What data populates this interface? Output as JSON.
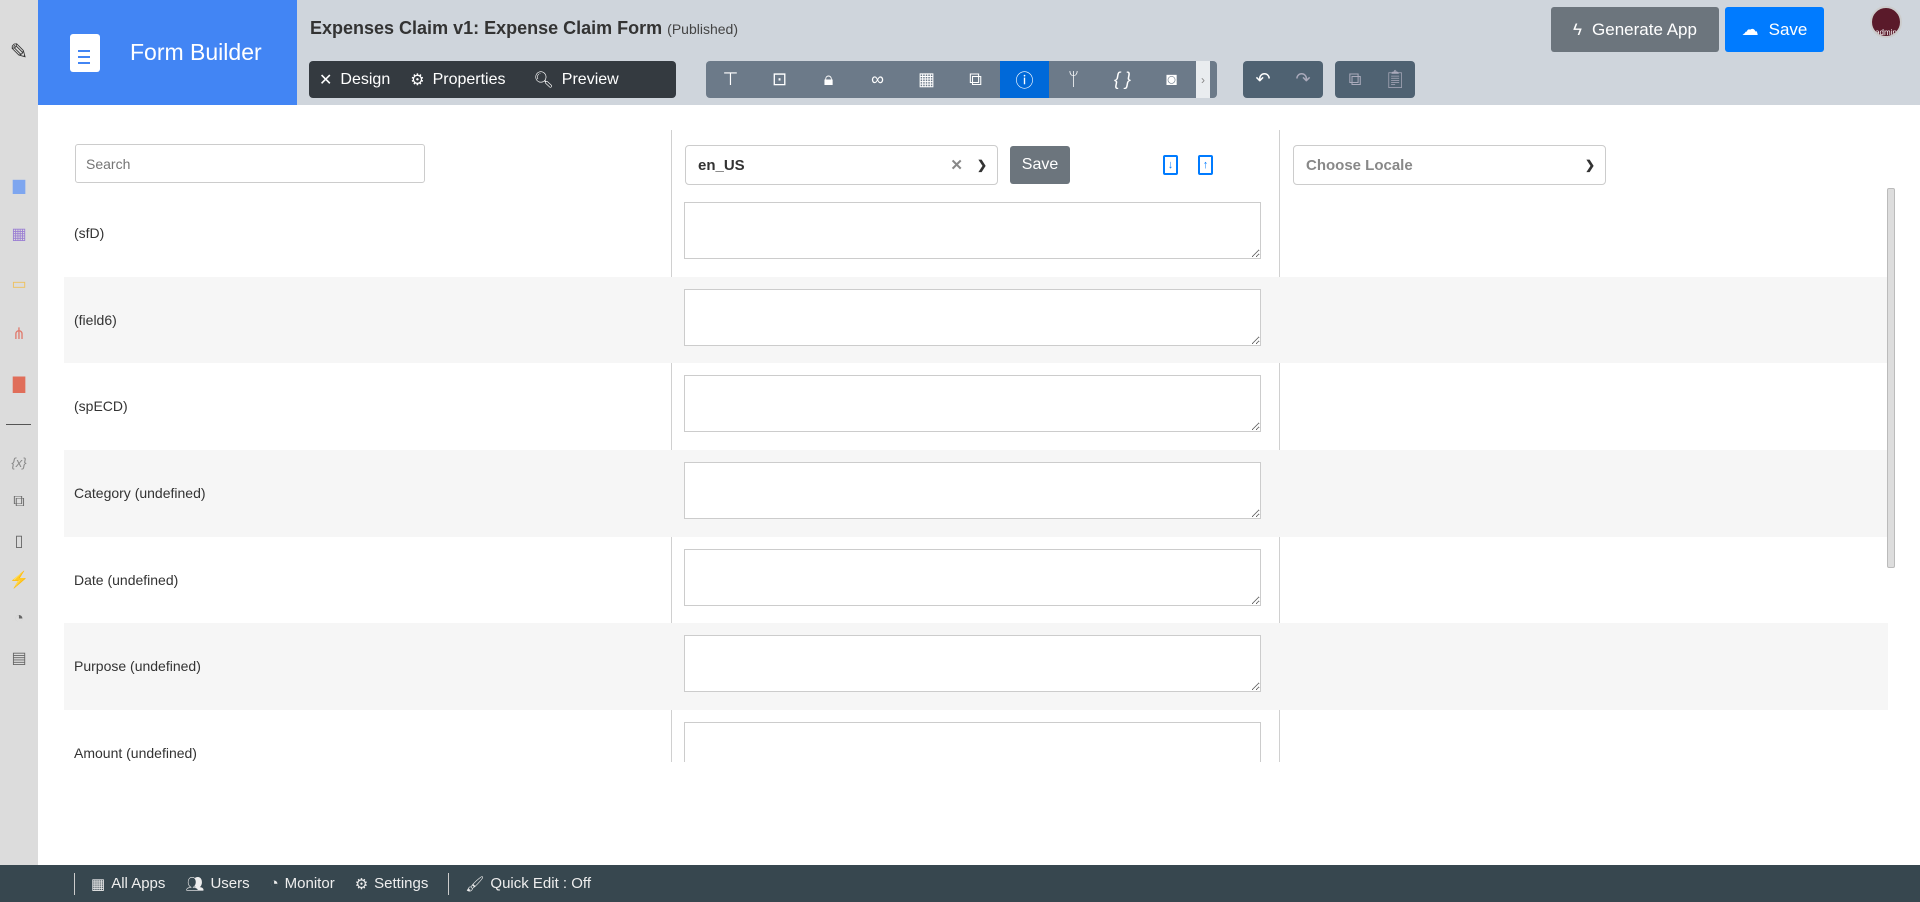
{
  "header": {
    "brand": "Form Builder",
    "title": "Expenses Claim v1: Expense Claim Form",
    "status": "(Published)",
    "tabs": [
      {
        "label": "Design",
        "icon": "design-icon"
      },
      {
        "label": "Properties",
        "icon": "gear-icon"
      },
      {
        "label": "Preview",
        "icon": "preview-icon"
      }
    ],
    "generate_label": "Generate App",
    "save_label": "Save",
    "avatar_label": "admin"
  },
  "search": {
    "placeholder": "Search"
  },
  "locale": {
    "value": "en_US",
    "save_label": "Save",
    "choose_placeholder": "Choose Locale"
  },
  "rows": [
    {
      "label": "(sfD)"
    },
    {
      "label": "(field6)"
    },
    {
      "label": "(spECD)"
    },
    {
      "label": "Category (undefined)"
    },
    {
      "label": "Date (undefined)"
    },
    {
      "label": "Purpose (undefined)"
    },
    {
      "label": "Amount (undefined)"
    }
  ],
  "footer": {
    "all_apps": "All Apps",
    "users": "Users",
    "monitor": "Monitor",
    "settings": "Settings",
    "quick_edit": "Quick Edit : Off"
  }
}
